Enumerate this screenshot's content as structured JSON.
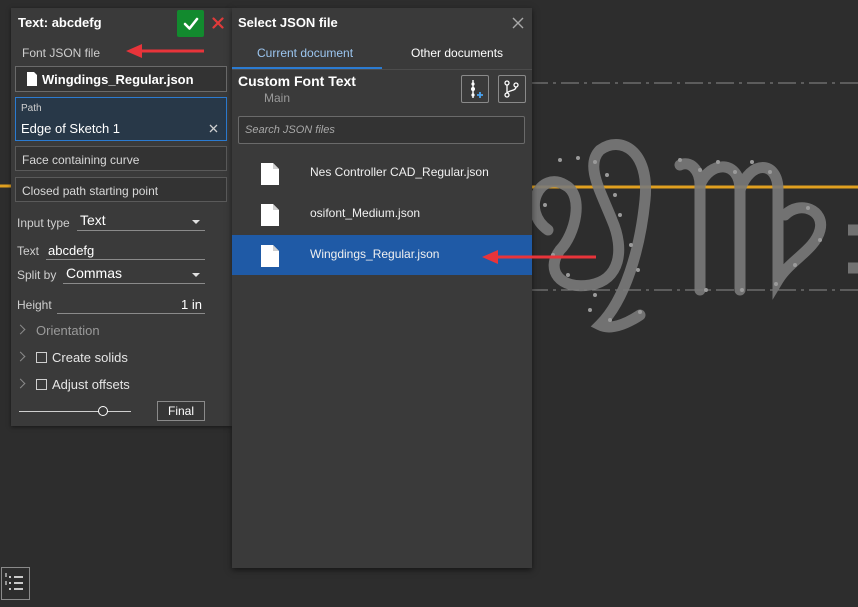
{
  "colors": {
    "accent": "#2b7bd1",
    "selected_row": "#1f5aa6",
    "confirm_green": "#128a2e",
    "cancel_red": "#e03a3a",
    "annotation_arrow": "#e8343a",
    "sketch_line": "#e0a020"
  },
  "feature": {
    "title": "Text: abcdefg",
    "font_json_label": "Font JSON file",
    "font_json_value": "Wingdings_Regular.json",
    "path_label": "Path",
    "path_value": "Edge of Sketch 1",
    "face_placeholder": "Face containing curve",
    "closed_path_placeholder": "Closed path starting point",
    "input_type_label": "Input type",
    "input_type_value": "Text",
    "text_label": "Text",
    "text_value": "abcdefg",
    "split_by_label": "Split by",
    "split_by_value": "Commas",
    "height_label": "Height",
    "height_value": "1 in",
    "orientation_label": "Orientation",
    "create_solids_label": "Create solids",
    "create_solids_checked": false,
    "adjust_offsets_label": "Adjust offsets",
    "adjust_offsets_checked": false,
    "slider_value": 0.75,
    "final_label": "Final"
  },
  "dialog": {
    "title": "Select JSON file",
    "tabs": [
      {
        "label": "Current document",
        "active": true
      },
      {
        "label": "Other documents",
        "active": false
      }
    ],
    "document_title": "Custom Font Text",
    "branch": "Main",
    "search_placeholder": "Search JSON files",
    "files": [
      {
        "name": "Nes Controller CAD_Regular.json",
        "selected": false
      },
      {
        "name": "osifont_Medium.json",
        "selected": false
      },
      {
        "name": "Wingdings_Regular.json",
        "selected": true
      }
    ]
  },
  "icons": [
    "check-icon",
    "close-icon",
    "file-icon",
    "insert-version-icon",
    "branch-icon",
    "list-icon",
    "chevron-right-icon"
  ]
}
